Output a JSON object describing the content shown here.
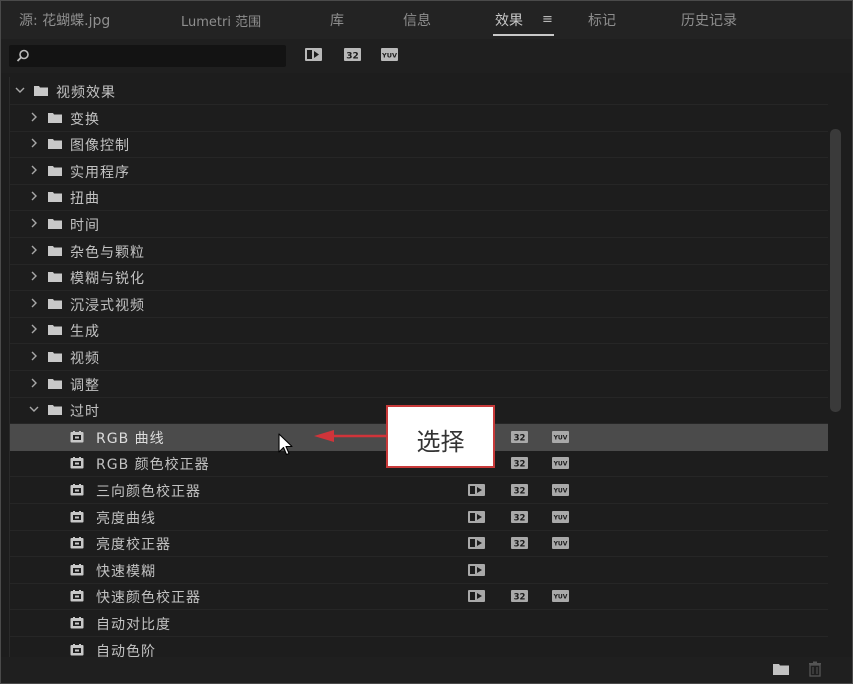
{
  "tabs": [
    {
      "label": "源: 花蝴蝶.jpg",
      "active": false
    },
    {
      "label": "Lumetri 范围",
      "active": false
    },
    {
      "label": "库",
      "active": false
    },
    {
      "label": "信息",
      "active": false
    },
    {
      "label": "效果",
      "active": true
    },
    {
      "label": "标记",
      "active": false
    },
    {
      "label": "历史记录",
      "active": false
    }
  ],
  "search": {
    "placeholder": ""
  },
  "filter_icons": [
    "accelerated-effects-icon",
    "32-bit-effects-icon",
    "yuv-effects-icon"
  ],
  "tree": [
    {
      "label": "视频效果",
      "expanded": true,
      "type": "folder"
    },
    {
      "label": "变换",
      "expanded": false,
      "type": "folder"
    },
    {
      "label": "图像控制",
      "expanded": false,
      "type": "folder"
    },
    {
      "label": "实用程序",
      "expanded": false,
      "type": "folder"
    },
    {
      "label": "扭曲",
      "expanded": false,
      "type": "folder"
    },
    {
      "label": "时间",
      "expanded": false,
      "type": "folder"
    },
    {
      "label": "杂色与颗粒",
      "expanded": false,
      "type": "folder"
    },
    {
      "label": "模糊与锐化",
      "expanded": false,
      "type": "folder"
    },
    {
      "label": "沉浸式视频",
      "expanded": false,
      "type": "folder"
    },
    {
      "label": "生成",
      "expanded": false,
      "type": "folder"
    },
    {
      "label": "视频",
      "expanded": false,
      "type": "folder"
    },
    {
      "label": "调整",
      "expanded": false,
      "type": "folder"
    },
    {
      "label": "过时",
      "expanded": true,
      "type": "folder"
    },
    {
      "label": "RGB 曲线",
      "type": "effect",
      "selected": true,
      "accel": false,
      "b32": true,
      "yuv": true
    },
    {
      "label": "RGB 颜色校正器",
      "type": "effect",
      "accel": false,
      "b32": true,
      "yuv": true
    },
    {
      "label": "三向颜色校正器",
      "type": "effect",
      "accel": true,
      "b32": true,
      "yuv": true
    },
    {
      "label": "亮度曲线",
      "type": "effect",
      "accel": true,
      "b32": true,
      "yuv": true
    },
    {
      "label": "亮度校正器",
      "type": "effect",
      "accel": true,
      "b32": true,
      "yuv": true
    },
    {
      "label": "快速模糊",
      "type": "effect",
      "accel": true,
      "b32": false,
      "yuv": false
    },
    {
      "label": "快速颜色校正器",
      "type": "effect",
      "accel": true,
      "b32": true,
      "yuv": true
    },
    {
      "label": "自动对比度",
      "type": "effect",
      "accel": false,
      "b32": false,
      "yuv": false
    },
    {
      "label": "自动色阶",
      "type": "effect",
      "accel": false,
      "b32": false,
      "yuv": false
    }
  ],
  "callout": {
    "text": "选择"
  },
  "bottom_icons": [
    "new-bin-icon",
    "trash-icon"
  ],
  "colors": {
    "callout_border": "#c83a3a",
    "arrow": "#d0343a",
    "selected_row": "#4b4b4b"
  }
}
